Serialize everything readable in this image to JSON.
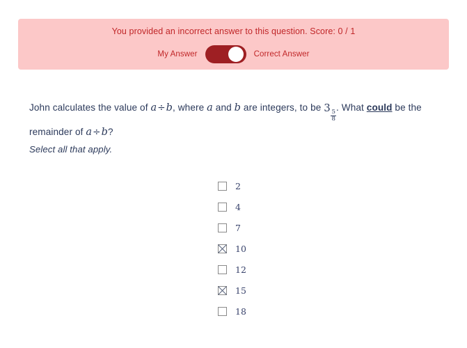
{
  "banner": {
    "headline": "You provided an incorrect answer to this question. Score: 0 / 1",
    "my_answer_label": "My Answer",
    "correct_answer_label": "Correct Answer",
    "toggle_state": "correct-answer",
    "background_color": "#fcc8c8",
    "text_color": "#c02628",
    "toggle_track_color": "#9e1f23",
    "toggle_knob_color": "#ffffff"
  },
  "question": {
    "line1_before": "John calculates the value of ",
    "var_a": "a",
    "divide": "÷",
    "var_b": "b",
    "line1_mid": ", where ",
    "line1_and": " and ",
    "line1_after": " are integers, to be ",
    "whole_number": "3",
    "numerator": "5",
    "denominator": "8",
    "line1_tail_before": ". What ",
    "emphasis": "could",
    "line1_tail_after": " be",
    "line2_before": "the remainder of ",
    "line2_after": "?",
    "instruction": "Select all that apply.",
    "text_color": "#2c3a5b"
  },
  "options": [
    {
      "label": "2",
      "checked": false
    },
    {
      "label": "4",
      "checked": false
    },
    {
      "label": "7",
      "checked": false
    },
    {
      "label": "10",
      "checked": true
    },
    {
      "label": "12",
      "checked": false
    },
    {
      "label": "15",
      "checked": true
    },
    {
      "label": "18",
      "checked": false
    }
  ]
}
